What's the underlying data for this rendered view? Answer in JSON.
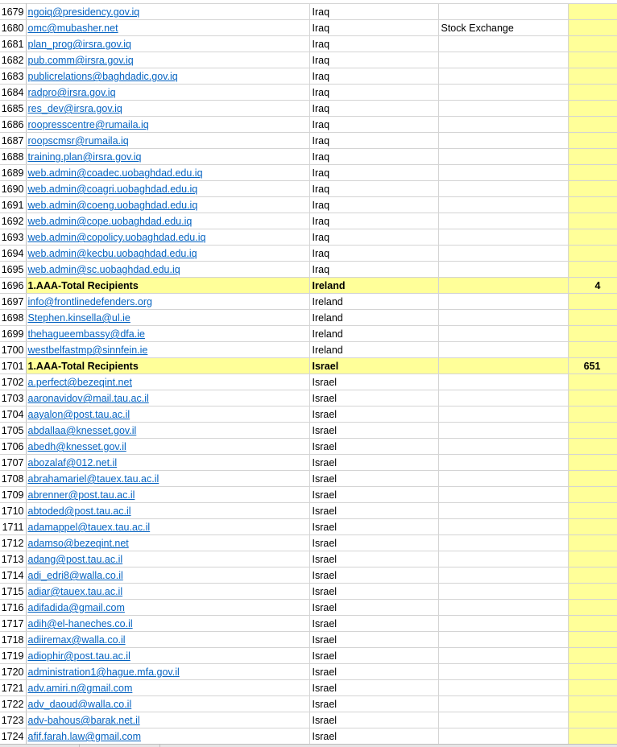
{
  "rows": [
    {
      "num": "1679",
      "email": "ngoiq@presidency.gov.iq",
      "country": "Iraq",
      "note": "",
      "total": ""
    },
    {
      "num": "1680",
      "email": "omc@mubasher.net",
      "country": "Iraq",
      "note": "Stock Exchange",
      "total": ""
    },
    {
      "num": "1681",
      "email": "plan_prog@irsra.gov.iq",
      "country": "Iraq",
      "note": "",
      "total": ""
    },
    {
      "num": "1682",
      "email": "pub.comm@irsra.gov.iq",
      "country": "Iraq",
      "note": "",
      "total": ""
    },
    {
      "num": "1683",
      "email": "publicrelations@baghdadic.gov.iq",
      "country": "Iraq",
      "note": "",
      "total": ""
    },
    {
      "num": "1684",
      "email": "radpro@irsra.gov.iq",
      "country": "Iraq",
      "note": "",
      "total": ""
    },
    {
      "num": "1685",
      "email": "res_dev@irsra.gov.iq",
      "country": "Iraq",
      "note": "",
      "total": ""
    },
    {
      "num": "1686",
      "email": "roopresscentre@rumaila.iq",
      "country": "Iraq",
      "note": "",
      "total": ""
    },
    {
      "num": "1687",
      "email": "roopscmsr@rumaila.iq",
      "country": "Iraq",
      "note": "",
      "total": ""
    },
    {
      "num": "1688",
      "email": "training.plan@irsra.gov.iq",
      "country": "Iraq",
      "note": "",
      "total": ""
    },
    {
      "num": "1689",
      "email": "web.admin@coadec.uobaghdad.edu.iq",
      "country": "Iraq",
      "note": "",
      "total": ""
    },
    {
      "num": "1690",
      "email": "web.admin@coagri.uobaghdad.edu.iq",
      "country": "Iraq",
      "note": "",
      "total": ""
    },
    {
      "num": "1691",
      "email": "web.admin@coeng.uobaghdad.edu.iq",
      "country": "Iraq",
      "note": "",
      "total": ""
    },
    {
      "num": "1692",
      "email": "web.admin@cope.uobaghdad.edu.iq",
      "country": "Iraq",
      "note": "",
      "total": ""
    },
    {
      "num": "1693",
      "email": "web.admin@copolicy.uobaghdad.edu.iq",
      "country": "Iraq",
      "note": "",
      "total": ""
    },
    {
      "num": "1694",
      "email": "web.admin@kecbu.uobaghdad.edu.iq",
      "country": "Iraq",
      "note": "",
      "total": ""
    },
    {
      "num": "1695",
      "email": "web.admin@sc.uobaghdad.edu.iq",
      "country": "Iraq",
      "note": "",
      "total": ""
    },
    {
      "num": "1696",
      "email": "1.AAA-Total Recipients",
      "country": "Ireland",
      "note": "",
      "total": "4",
      "summary": true
    },
    {
      "num": "1697",
      "email": "info@frontlinedefenders.org",
      "country": "Ireland",
      "note": "",
      "total": ""
    },
    {
      "num": "1698",
      "email": "Stephen.kinsella@ul.ie",
      "country": "Ireland",
      "note": "",
      "total": ""
    },
    {
      "num": "1699",
      "email": "thehagueembassy@dfa.ie",
      "country": "Ireland",
      "note": "",
      "total": ""
    },
    {
      "num": "1700",
      "email": "westbelfastmp@sinnfein.ie",
      "country": "Ireland",
      "note": "",
      "total": ""
    },
    {
      "num": "1701",
      "email": "1.AAA-Total Recipients",
      "country": "Israel",
      "note": "",
      "total": "651",
      "summary": true
    },
    {
      "num": "1702",
      "email": "a.perfect@bezeqint.net",
      "country": "Israel",
      "note": "",
      "total": ""
    },
    {
      "num": "1703",
      "email": "aaronavidov@mail.tau.ac.il",
      "country": "Israel",
      "note": "",
      "total": ""
    },
    {
      "num": "1704",
      "email": "aayalon@post.tau.ac.il",
      "country": "Israel",
      "note": "",
      "total": ""
    },
    {
      "num": "1705",
      "email": "abdallaa@knesset.gov.il",
      "country": "Israel",
      "note": "",
      "total": ""
    },
    {
      "num": "1706",
      "email": "abedh@knesset.gov.il",
      "country": "Israel",
      "note": "",
      "total": ""
    },
    {
      "num": "1707",
      "email": "abozalaf@012.net.il",
      "country": "Israel",
      "note": "",
      "total": ""
    },
    {
      "num": "1708",
      "email": "abrahamariel@tauex.tau.ac.il",
      "country": "Israel",
      "note": "",
      "total": ""
    },
    {
      "num": "1709",
      "email": "abrenner@post.tau.ac.il",
      "country": "Israel",
      "note": "",
      "total": ""
    },
    {
      "num": "1710",
      "email": "abtoded@post.tau.ac.il",
      "country": "Israel",
      "note": "",
      "total": ""
    },
    {
      "num": "1711",
      "email": "adamappel@tauex.tau.ac.il",
      "country": "Israel",
      "note": "",
      "total": ""
    },
    {
      "num": "1712",
      "email": "adamso@bezeqint.net",
      "country": "Israel",
      "note": "",
      "total": ""
    },
    {
      "num": "1713",
      "email": "adang@post.tau.ac.il",
      "country": "Israel",
      "note": "",
      "total": ""
    },
    {
      "num": "1714",
      "email": "adi_edri8@walla.co.il",
      "country": "Israel",
      "note": "",
      "total": ""
    },
    {
      "num": "1715",
      "email": "adiar@tauex.tau.ac.il",
      "country": "Israel",
      "note": "",
      "total": ""
    },
    {
      "num": "1716",
      "email": "adifadida@gmail.com",
      "country": "Israel",
      "note": "",
      "total": ""
    },
    {
      "num": "1717",
      "email": "adih@el-haneches.co.il",
      "country": "Israel",
      "note": "",
      "total": ""
    },
    {
      "num": "1718",
      "email": "adiiremax@walla.co.il",
      "country": "Israel",
      "note": "",
      "total": ""
    },
    {
      "num": "1719",
      "email": "adiophir@post.tau.ac.il",
      "country": "Israel",
      "note": "",
      "total": ""
    },
    {
      "num": "1720",
      "email": "administration1@hague.mfa.gov.il",
      "country": "Israel",
      "note": "",
      "total": ""
    },
    {
      "num": "1721",
      "email": "adv.amiri.n@gmail.com",
      "country": "Israel",
      "note": "",
      "total": ""
    },
    {
      "num": "1722",
      "email": "adv_daoud@walla.co.il",
      "country": "Israel",
      "note": "",
      "total": ""
    },
    {
      "num": "1723",
      "email": "adv-bahous@barak.net.il",
      "country": "Israel",
      "note": "",
      "total": ""
    },
    {
      "num": "1724",
      "email": "afif.farah.law@gmail.com",
      "country": "Israel",
      "note": "",
      "total": ""
    }
  ]
}
